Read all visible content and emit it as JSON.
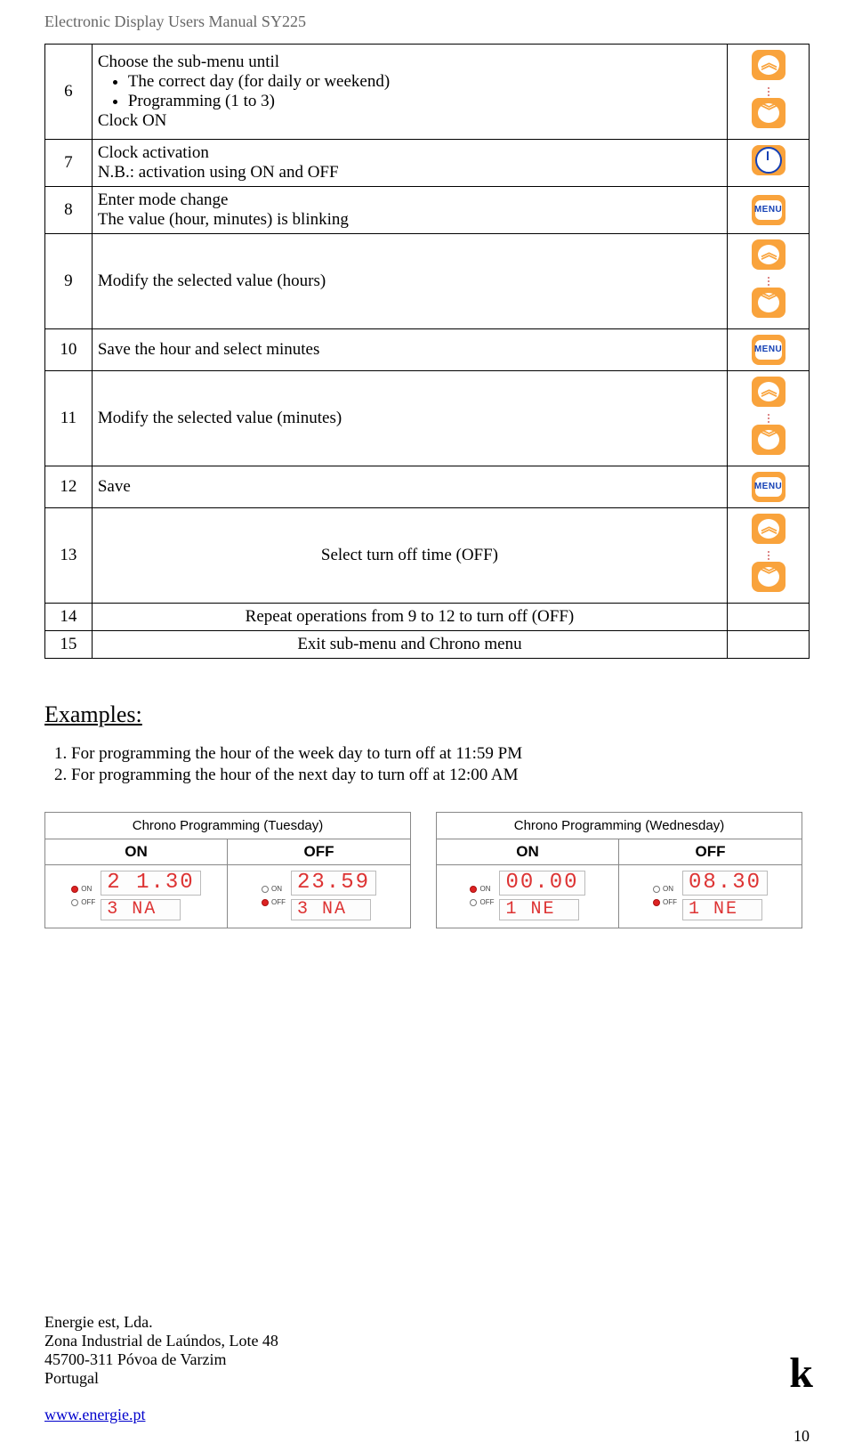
{
  "header": "Electronic Display Users Manual SY225",
  "rows": [
    {
      "num": "6",
      "lines": [
        "Choose the sub-menu until"
      ],
      "bullets": [
        "The correct day (for daily or weekend)",
        "Programming (1 to 3)"
      ],
      "tail": "Clock ON",
      "icons": [
        "up",
        "down"
      ]
    },
    {
      "num": "7",
      "lines": [
        "Clock activation",
        "N.B.: activation using ON and OFF"
      ],
      "icons": [
        "clock"
      ]
    },
    {
      "num": "8",
      "lines": [
        "Enter mode change",
        "The value (hour, minutes) is blinking"
      ],
      "icons": [
        "menu"
      ]
    },
    {
      "num": "9",
      "lines": [
        "Modify the selected value (hours)"
      ],
      "icons": [
        "up",
        "down"
      ],
      "tall": true
    },
    {
      "num": "10",
      "lines": [
        "Save the hour and select minutes"
      ],
      "icons": [
        "menu"
      ]
    },
    {
      "num": "11",
      "lines": [
        "Modify the selected value (minutes)"
      ],
      "icons": [
        "up",
        "down"
      ],
      "tall": true
    },
    {
      "num": "12",
      "lines": [
        "Save"
      ],
      "icons": [
        "menu"
      ]
    },
    {
      "num": "13",
      "center": "Select turn off time (OFF)",
      "icons": [
        "up",
        "down"
      ],
      "tall": true
    },
    {
      "num": "14",
      "center": "Repeat operations from 9 to 12 to turn off (OFF)",
      "icons": []
    },
    {
      "num": "15",
      "center": "Exit sub-menu and Chrono menu",
      "icons": []
    }
  ],
  "menu_label": "MENU",
  "examples_h": "Examples:",
  "examples": [
    "For programming the hour of the week day to turn off at 11:59 PM",
    "For programming the hour of the next day to turn off at 12:00 AM"
  ],
  "panels": [
    {
      "title": "Chrono Programming (Tuesday)",
      "on": {
        "led_on": true,
        "time": "2 1.30",
        "sub": "3  NA"
      },
      "off": {
        "led_on": false,
        "time": "23.59",
        "sub": "3  NA"
      }
    },
    {
      "title": "Chrono Programming (Wednesday)",
      "on": {
        "led_on": true,
        "time": "00.00",
        "sub": "1  NE"
      },
      "off": {
        "led_on": false,
        "time": "08.30",
        "sub": "1  NE"
      }
    }
  ],
  "on_label": "ON",
  "off_label": "OFF",
  "led_on_label": "ON",
  "led_off_label": "OFF",
  "footer": {
    "l1": "Energie est, Lda.",
    "l2": "Zona Industrial de Laúndos, Lote 48",
    "l3": "45700-311 Póvoa de Varzim",
    "l4": "Portugal",
    "link": "www.energie.pt"
  },
  "page_number": "10",
  "logo": "k"
}
